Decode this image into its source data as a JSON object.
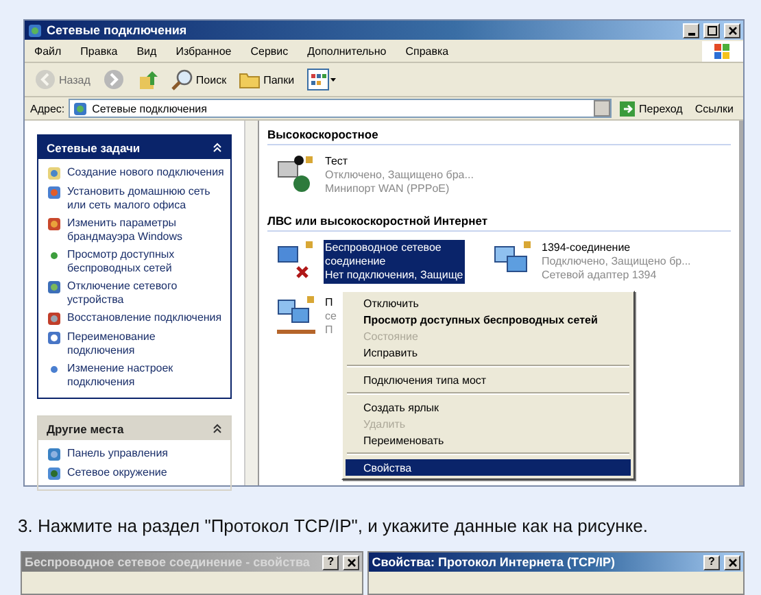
{
  "window": {
    "title": "Сетевые подключения"
  },
  "menu_bar": [
    "Файл",
    "Правка",
    "Вид",
    "Избранное",
    "Сервис",
    "Дополнительно",
    "Справка"
  ],
  "toolbar": [
    {
      "kind": "back",
      "label": "Назад",
      "disabled": true
    },
    {
      "kind": "forward",
      "disabled": false
    },
    {
      "kind": "up",
      "disabled": false
    },
    {
      "kind": "search",
      "label": "Поиск",
      "disabled": false
    },
    {
      "kind": "folders",
      "label": "Папки",
      "disabled": false
    },
    {
      "kind": "views",
      "disabled": false
    }
  ],
  "address": {
    "label": "Адрес:",
    "value": "Сетевые подключения",
    "go": "Переход",
    "links": "Ссылки"
  },
  "sidebar": {
    "panels": [
      {
        "title": "Сетевые задачи",
        "kind": "special",
        "expanded": true,
        "items": [
          "Создание нового подключения",
          "Установить домашнюю сеть или сеть малого офиса",
          "Изменить параметры брандмауэра Windows",
          "Просмотр доступных беспроводных сетей",
          "Отключение сетевого устройства",
          "Восстановление подключения",
          "Переименование подключения",
          "Изменение настроек подключения"
        ]
      },
      {
        "title": "Другие места",
        "kind": "normal",
        "expanded": true,
        "items": [
          "Панель управления",
          "Сетевое окружение"
        ]
      }
    ]
  },
  "content": {
    "groups": [
      {
        "title": "Высокоскоростное",
        "items": [
          {
            "kind": "wan",
            "selected": false,
            "lines": [
              "Тест",
              "Отключено, Защищено бра...",
              "Минипорт WAN (PPPoE)"
            ]
          }
        ]
      },
      {
        "title": "ЛВС или высокоскоростной Интернет",
        "items": [
          {
            "kind": "wireless",
            "selected": true,
            "lines": [
              "Беспроводное сетевое",
              "соединение",
              "Нет подключения, Защище"
            ]
          },
          {
            "kind": "lan",
            "selected": false,
            "lines": [
              "1394-соединение",
              "Подключено, Защищено бр...",
              "Сетевой адаптер 1394"
            ]
          },
          {
            "kind": "bridge",
            "selected": false,
            "lines": [
              "П",
              "се",
              "П"
            ]
          }
        ]
      }
    ]
  },
  "context_menu": [
    {
      "kind": "item",
      "label": "Отключить",
      "bold": false,
      "disabled": false,
      "selected": false
    },
    {
      "kind": "item",
      "label": "Просмотр доступных беспроводных сетей",
      "bold": true,
      "disabled": false,
      "selected": false
    },
    {
      "kind": "item",
      "label": "Состояние",
      "bold": false,
      "disabled": true,
      "selected": false
    },
    {
      "kind": "item",
      "label": "Исправить",
      "bold": false,
      "disabled": false,
      "selected": false
    },
    {
      "kind": "separator"
    },
    {
      "kind": "item",
      "label": "Подключения типа мост",
      "bold": false,
      "disabled": false,
      "selected": false
    },
    {
      "kind": "separator"
    },
    {
      "kind": "item",
      "label": "Создать ярлык",
      "bold": false,
      "disabled": false,
      "selected": false
    },
    {
      "kind": "item",
      "label": "Удалить",
      "bold": false,
      "disabled": true,
      "selected": false
    },
    {
      "kind": "item",
      "label": "Переименовать",
      "bold": false,
      "disabled": false,
      "selected": false
    },
    {
      "kind": "separator"
    },
    {
      "kind": "item",
      "label": "Свойства",
      "bold": false,
      "disabled": false,
      "selected": true
    }
  ],
  "instruction": "3. Нажмите на раздел \"Протокол TCP/IP\", и укажите данные как на рисунке.",
  "dialogs": [
    {
      "title": "Беспроводное сетевое соединение - свойства",
      "active": false,
      "help": "?"
    },
    {
      "title": "Свойства: Протокол Интернета (TCP/IP)",
      "active": true,
      "help": "?"
    }
  ]
}
